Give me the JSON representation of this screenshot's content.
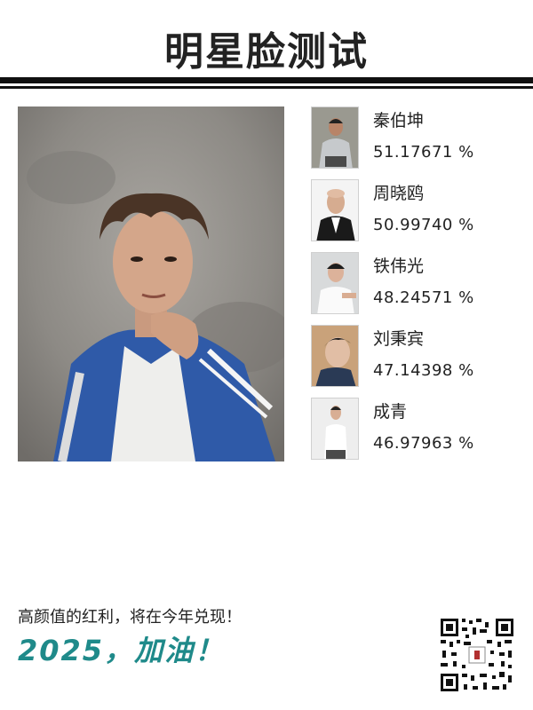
{
  "header": {
    "title": "明星脸测试"
  },
  "main_photo": {
    "kind": "uploaded-face-photo"
  },
  "matches": [
    {
      "name": "秦伯坤",
      "score": "51.17671 %"
    },
    {
      "name": "周晓鸥",
      "score": "50.99740 %"
    },
    {
      "name": "铁伟光",
      "score": "48.24571 %"
    },
    {
      "name": "刘秉宾",
      "score": "47.14398 %"
    },
    {
      "name": "成青",
      "score": "46.97963 %"
    }
  ],
  "footer": {
    "slogan": "高颜值的红利，将在今年兑现！",
    "cheer": "2025，加油！",
    "qr_icon": "qr-code-icon"
  },
  "colors": {
    "title": "#222222",
    "rule": "#111111",
    "cheer": "#1f8a8a"
  }
}
